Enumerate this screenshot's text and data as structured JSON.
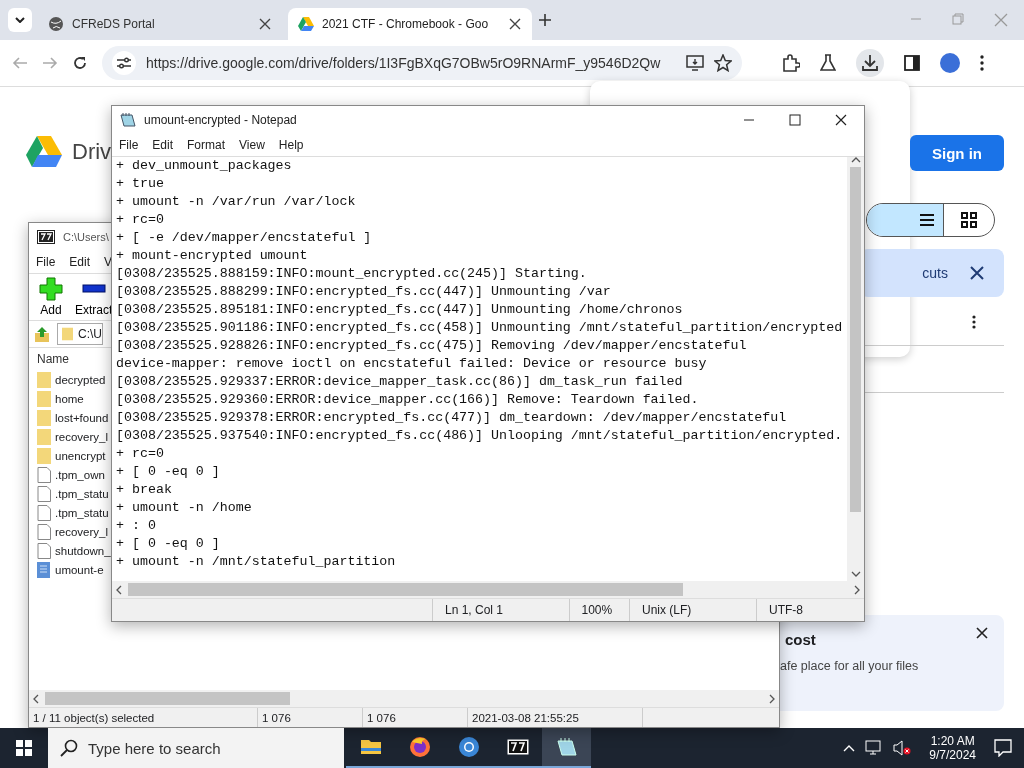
{
  "browser": {
    "tabs": [
      {
        "title": "CFReDS Portal",
        "kind": "globe",
        "selected": false
      },
      {
        "title": "2021 CTF - Chromebook - Goo",
        "kind": "drive",
        "selected": true
      }
    ],
    "url": "https://drive.google.com/drive/folders/1I3FgBXqG7OBw5rO9RNArmF_y9546D2Qw"
  },
  "drive": {
    "logo_text": "Driv",
    "sign_in": "Sign in",
    "banner": "cuts",
    "card_title": "cost",
    "card_text": "afe place for all your files"
  },
  "archive_window": {
    "title": "C:\\Users\\",
    "menu": [
      "File",
      "Edit",
      "V"
    ],
    "toolbar": [
      {
        "label": "Add",
        "kind": "add"
      },
      {
        "label": "Extract",
        "kind": "extract"
      }
    ],
    "path": "C:\\U",
    "column": "Name",
    "files": [
      {
        "name": "decrypted",
        "kind": "folder"
      },
      {
        "name": "home",
        "kind": "folder"
      },
      {
        "name": "lost+found",
        "kind": "folder"
      },
      {
        "name": "recovery_l",
        "kind": "folder"
      },
      {
        "name": "unencrypt",
        "kind": "folder"
      },
      {
        "name": ".tpm_own",
        "kind": "file"
      },
      {
        "name": ".tpm_statu",
        "kind": "file"
      },
      {
        "name": ".tpm_statu",
        "kind": "file"
      },
      {
        "name": "recovery_l",
        "kind": "file"
      },
      {
        "name": "shutdown_",
        "kind": "file"
      },
      {
        "name": "umount-e",
        "kind": "text"
      }
    ],
    "status": [
      "1 / 11 object(s) selected",
      "1 076",
      "1 076",
      "2021-03-08 21:55:25"
    ]
  },
  "notepad": {
    "title": "umount-encrypted - Notepad",
    "menu": [
      "File",
      "Edit",
      "Format",
      "View",
      "Help"
    ],
    "lines": [
      "+ dev_unmount_packages",
      "+ true",
      "+ umount -n /var/run /var/lock",
      "+ rc=0",
      "+ [ -e /dev/mapper/encstateful ]",
      "+ mount-encrypted umount",
      "[0308/235525.888159:INFO:mount_encrypted.cc(245)] Starting.",
      "[0308/235525.888299:INFO:encrypted_fs.cc(447)] Unmounting /var",
      "[0308/235525.895181:INFO:encrypted_fs.cc(447)] Unmounting /home/chronos",
      "[0308/235525.901186:INFO:encrypted_fs.cc(458)] Unmounting /mnt/stateful_partition/encrypted",
      "[0308/235525.928826:INFO:encrypted_fs.cc(475)] Removing /dev/mapper/encstateful",
      "device-mapper: remove ioctl on encstateful failed: Device or resource busy",
      "[0308/235525.929337:ERROR:device_mapper_task.cc(86)] dm_task_run failed",
      "[0308/235525.929360:ERROR:device_mapper.cc(166)] Remove: Teardown failed.",
      "[0308/235525.929378:ERROR:encrypted_fs.cc(477)] dm_teardown: /dev/mapper/encstateful",
      "[0308/235525.937540:INFO:encrypted_fs.cc(486)] Unlooping /mnt/stateful_partition/encrypted.",
      "+ rc=0",
      "+ [ 0 -eq 0 ]",
      "+ break",
      "+ umount -n /home",
      "+ : 0",
      "+ [ 0 -eq 0 ]",
      "+ umount -n /mnt/stateful_partition"
    ],
    "status": [
      "Ln 1, Col 1",
      "100%",
      "Unix (LF)",
      "UTF-8"
    ]
  },
  "taskbar": {
    "search_placeholder": "Type here to search",
    "apps": [
      {
        "kind": "explorer",
        "active": false
      },
      {
        "kind": "firefox",
        "active": false
      },
      {
        "kind": "chrome",
        "active": false
      },
      {
        "kind": "sevenzip",
        "active": false
      },
      {
        "kind": "notepad",
        "active": true
      }
    ],
    "time": "1:20 AM",
    "date": "9/7/2024"
  }
}
